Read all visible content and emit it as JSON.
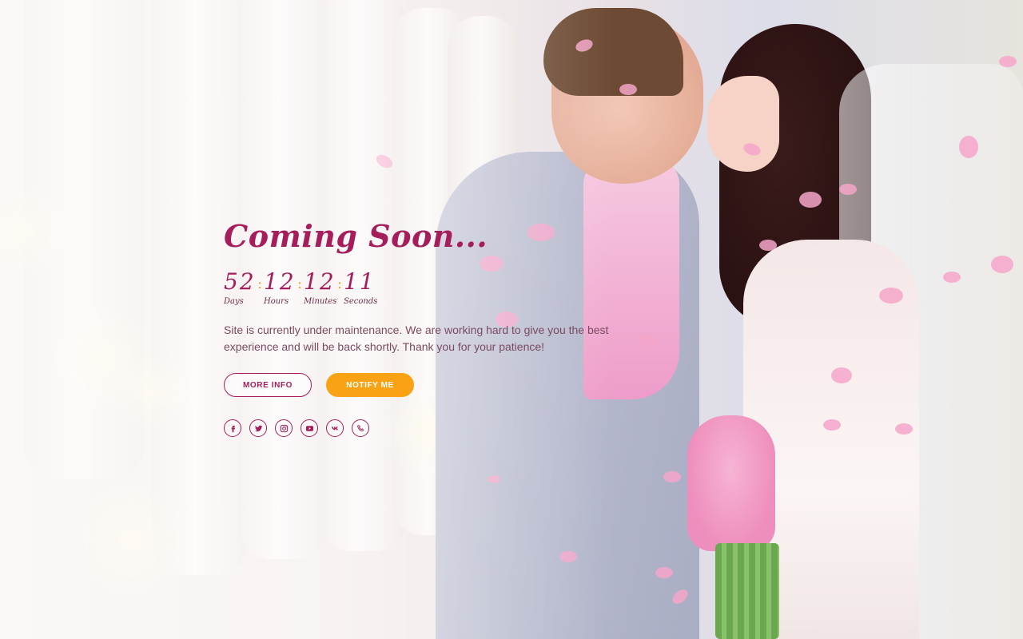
{
  "hero": {
    "title": "Coming Soon...",
    "description": "Site is currently under maintenance. We are working hard to give you the best experience and will be back shortly. Thank you for your patience!"
  },
  "countdown": {
    "days": {
      "value": "52",
      "label": "Days"
    },
    "hours": {
      "value": "12",
      "label": "Hours"
    },
    "minutes": {
      "value": "12",
      "label": "Minutes"
    },
    "seconds": {
      "value": "11",
      "label": "Seconds"
    },
    "separator": ":"
  },
  "buttons": {
    "more_info": "MORE INFO",
    "notify_me": "NOTIFY ME"
  },
  "social": [
    "facebook-icon",
    "twitter-icon",
    "instagram-icon",
    "youtube-icon",
    "vk-icon",
    "phone-icon"
  ],
  "colors": {
    "accent": "#a51e5b",
    "button_orange": "#f8a214",
    "text": "#7a4a60"
  }
}
